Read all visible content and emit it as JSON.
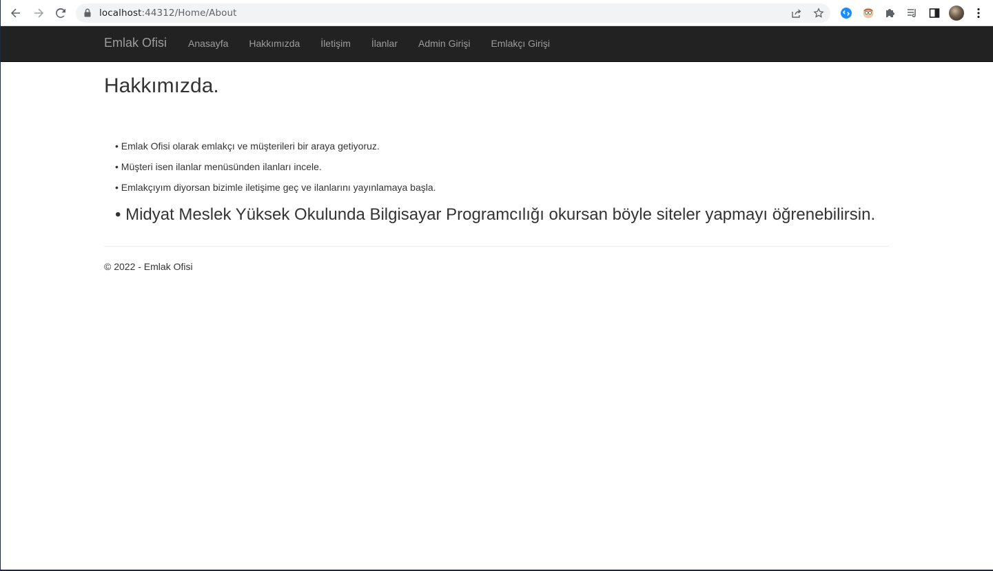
{
  "browser": {
    "url_host": "localhost",
    "url_path": ":44312/Home/About",
    "icons": [
      "back-arrow-icon",
      "forward-arrow-icon",
      "reload-icon",
      "lock-icon",
      "share-icon",
      "star-icon",
      "shazam-extension-icon",
      "avatar-extension-icon",
      "puzzle-icon",
      "reading-list-icon",
      "side-panel-icon",
      "profile-avatar",
      "kebab-menu-icon"
    ]
  },
  "navbar": {
    "brand": "Emlak Ofisi",
    "links": [
      "Anasayfa",
      "Hakkımızda",
      "İletişim",
      "İlanlar",
      "Admin Girişi",
      "Emlakçı Girişi"
    ],
    "background": "#222222",
    "link_color": "#9d9d9d"
  },
  "main": {
    "title": "Hakkımızda.",
    "items": [
      "• Emlak Ofisi olarak emlakçı ve müşterileri bir araya getiyoruz.",
      "• Müşteri isen ilanlar menüsünden ilanları incele.",
      "• Emlakçıyım diyorsan bizimle iletişime geç ve ilanlarını yayınlamaya başla."
    ],
    "highlight": "• Midyat Meslek Yüksek Okulunda Bilgisayar Programcılığı okursan böyle siteler yapmayı öğrenebilirsin."
  },
  "footer": {
    "text": "© 2022 - Emlak Ofisi"
  }
}
